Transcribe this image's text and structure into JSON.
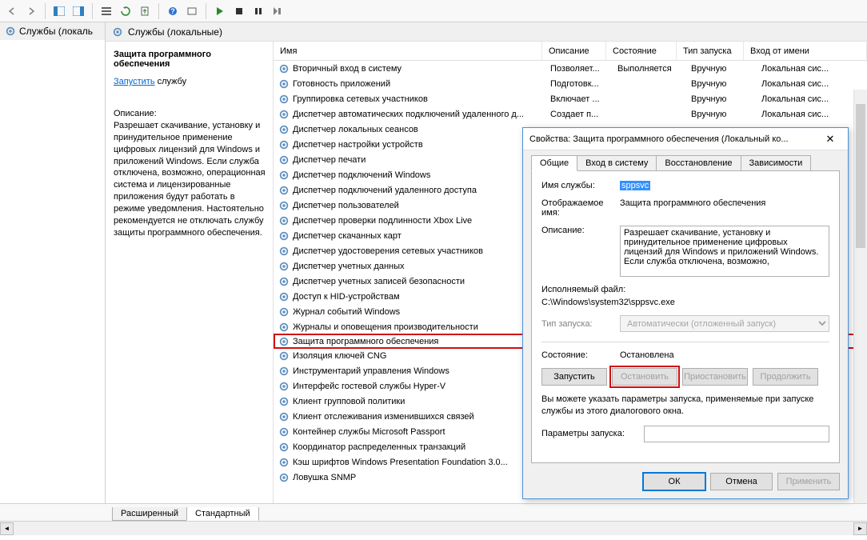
{
  "toolbar": {
    "icons": [
      "nav-back",
      "nav-fwd",
      "panel-left",
      "panel-right",
      "list",
      "refresh",
      "export",
      "help",
      "filter",
      "run",
      "stop",
      "pause",
      "step"
    ]
  },
  "left_tree": {
    "item": "Службы (локаль"
  },
  "content_header": "Службы (локальные)",
  "detail": {
    "title": "Защита программного обеспечения",
    "action_link": "Запустить",
    "action_suffix": " службу",
    "desc_label": "Описание:",
    "desc_text": "Разрешает скачивание, установку и принудительное применение цифровых лицензий для Windows и приложений Windows. Если служба отключена, возможно, операционная система и лицензированные приложения будут работать в режиме уведомления. Настоятельно рекомендуется не отключать службу защиты программного обеспечения."
  },
  "columns": {
    "name": "Имя",
    "desc": "Описание",
    "state": "Состояние",
    "startup": "Тип запуска",
    "logon": "Вход от имени"
  },
  "services": [
    {
      "n": "Вторичный вход в систему",
      "d": "Позволяет...",
      "s": "Выполняется",
      "t": "Вручную",
      "l": "Локальная сис..."
    },
    {
      "n": "Готовность приложений",
      "d": "Подготовк...",
      "s": "",
      "t": "Вручную",
      "l": "Локальная сис..."
    },
    {
      "n": "Группировка сетевых участников",
      "d": "Включает ...",
      "s": "",
      "t": "Вручную",
      "l": "Локальная сис..."
    },
    {
      "n": "Диспетчер автоматических подключений удаленного д...",
      "d": "Создает п...",
      "s": "",
      "t": "Вручную",
      "l": "Локальная сис..."
    },
    {
      "n": "Диспетчер локальных сеансов"
    },
    {
      "n": "Диспетчер настройки устройств"
    },
    {
      "n": "Диспетчер печати"
    },
    {
      "n": "Диспетчер подключений Windows"
    },
    {
      "n": "Диспетчер подключений удаленного доступа"
    },
    {
      "n": "Диспетчер пользователей"
    },
    {
      "n": "Диспетчер проверки подлинности Xbox Live"
    },
    {
      "n": "Диспетчер скачанных карт"
    },
    {
      "n": "Диспетчер удостоверения сетевых участников"
    },
    {
      "n": "Диспетчер учетных данных"
    },
    {
      "n": "Диспетчер учетных записей безопасности"
    },
    {
      "n": "Доступ к HID-устройствам"
    },
    {
      "n": "Журнал событий Windows"
    },
    {
      "n": "Журналы и оповещения производительности"
    },
    {
      "n": "Защита программного обеспечения",
      "hl": true
    },
    {
      "n": "Изоляция ключей CNG"
    },
    {
      "n": "Инструментарий управления Windows"
    },
    {
      "n": "Интерфейс гостевой службы Hyper-V"
    },
    {
      "n": "Клиент групповой политики"
    },
    {
      "n": "Клиент отслеживания изменившихся связей"
    },
    {
      "n": "Контейнер службы Microsoft Passport"
    },
    {
      "n": "Координатор распределенных транзакций"
    },
    {
      "n": "Кэш шрифтов Windows Presentation Foundation 3.0..."
    },
    {
      "n": "Ловушка SNMP"
    }
  ],
  "tabs": {
    "extended": "Расширенный",
    "standard": "Стандартный"
  },
  "dialog": {
    "title": "Свойства: Защита программного обеспечения (Локальный ко...",
    "tabs": {
      "general": "Общие",
      "logon": "Вход в систему",
      "recovery": "Восстановление",
      "deps": "Зависимости"
    },
    "fields": {
      "svcname_label": "Имя службы:",
      "svcname_value": "sppsvc",
      "dispname_label": "Отображаемое имя:",
      "dispname_value": "Защита программного обеспечения",
      "desc_label": "Описание:",
      "desc_value": "Разрешает скачивание, установку и принудительное применение цифровых лицензий для Windows и приложений Windows. Если служба отключена, возможно,",
      "exe_label": "Исполняемый файл:",
      "exe_value": "C:\\Windows\\system32\\sppsvc.exe",
      "startup_label": "Тип запуска:",
      "startup_value": "Автоматически (отложенный запуск)",
      "state_label": "Состояние:",
      "state_value": "Остановлена",
      "note": "Вы можете указать параметры запуска, применяемые при запуске службы из этого диалогового окна.",
      "params_label": "Параметры запуска:"
    },
    "buttons": {
      "start": "Запустить",
      "stop": "Остановить",
      "pause": "Приостановить",
      "resume": "Продолжить",
      "ok": "ОК",
      "cancel": "Отмена",
      "apply": "Применить"
    }
  }
}
